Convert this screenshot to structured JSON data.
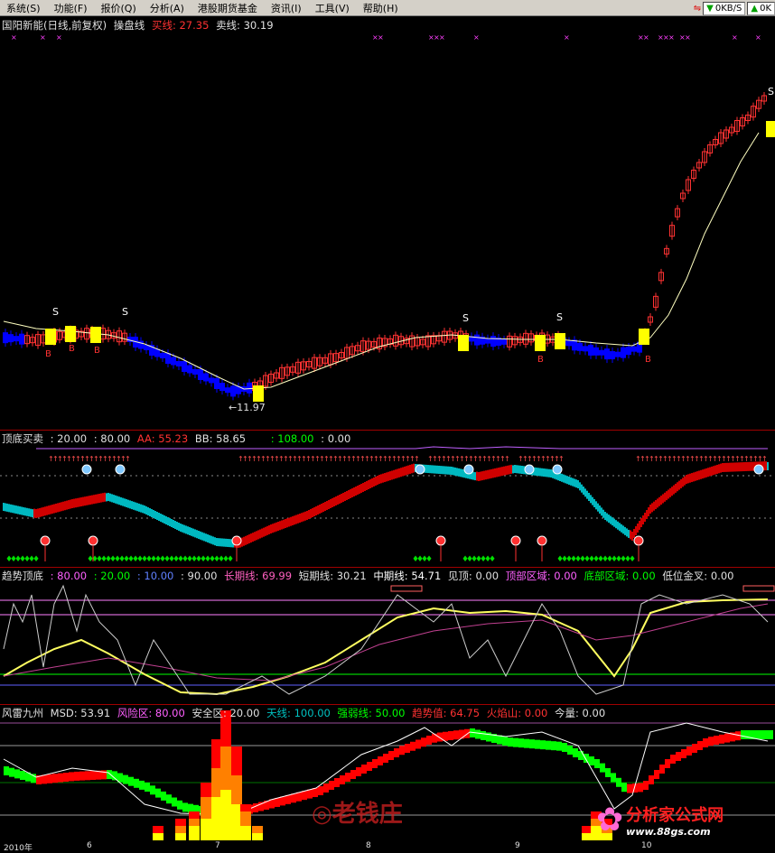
{
  "menus": [
    {
      "label": "系统(S)"
    },
    {
      "label": "功能(F)"
    },
    {
      "label": "报价(Q)"
    },
    {
      "label": "分析(A)"
    },
    {
      "label": "港股期货基金"
    },
    {
      "label": "资讯(I)"
    },
    {
      "label": "工具(V)"
    },
    {
      "label": "帮助(H)"
    }
  ],
  "status": {
    "down": "0KB/S",
    "up": "0K"
  },
  "pane1": {
    "name": "国阳新能(日线,前复权)",
    "indicator": "操盘线",
    "buy_label": "买线: 27.35",
    "sell_label": "卖线: 30.19",
    "low_price": "←11.97"
  },
  "pane2": {
    "name": "顶底买卖",
    "p1": ": 20.00",
    "p2": ": 80.00",
    "aa": "AA: 55.23",
    "bb": "BB: 58.65",
    "p3": ": 108.00",
    "p4": ": 0.00"
  },
  "pane3": {
    "name": "趋势顶底",
    "v1": ": 80.00",
    "v2": ": 20.00",
    "v3": ": 10.00",
    "v4": ": 90.00",
    "long": "长期线: 69.99",
    "short": "短期线: 30.21",
    "mid": "中期线: 54.71",
    "peak": "见顶: 0.00",
    "top_zone": "顶部区域: 0.00",
    "bottom_zone": "底部区域: 0.00",
    "gold": "低位金叉: 0.00"
  },
  "pane4": {
    "name": "风雷九州",
    "msd": "MSD: 53.91",
    "risk": "风险区: 80.00",
    "safe": "安全区: 20.00",
    "sky": "天线: 100.00",
    "strong": "强弱线: 50.00",
    "trend": "趋势值: 64.75",
    "volcano": "火焰山: 0.00",
    "vol": "今量: 0.00"
  },
  "axis": {
    "year": "2010年",
    "m6": "6",
    "m7": "7",
    "m8": "8",
    "m9": "9",
    "m10": "10"
  },
  "watermarks": {
    "center": "老钱庄",
    "brand": "分析家公式网",
    "url": "www.88gs.com"
  },
  "colors": {
    "up": "#ff3232",
    "down": "#0000ff",
    "buy": "#ffff00",
    "bull": "#e00000",
    "bear": "#00c0c0",
    "pane_border": "#a00000"
  }
}
